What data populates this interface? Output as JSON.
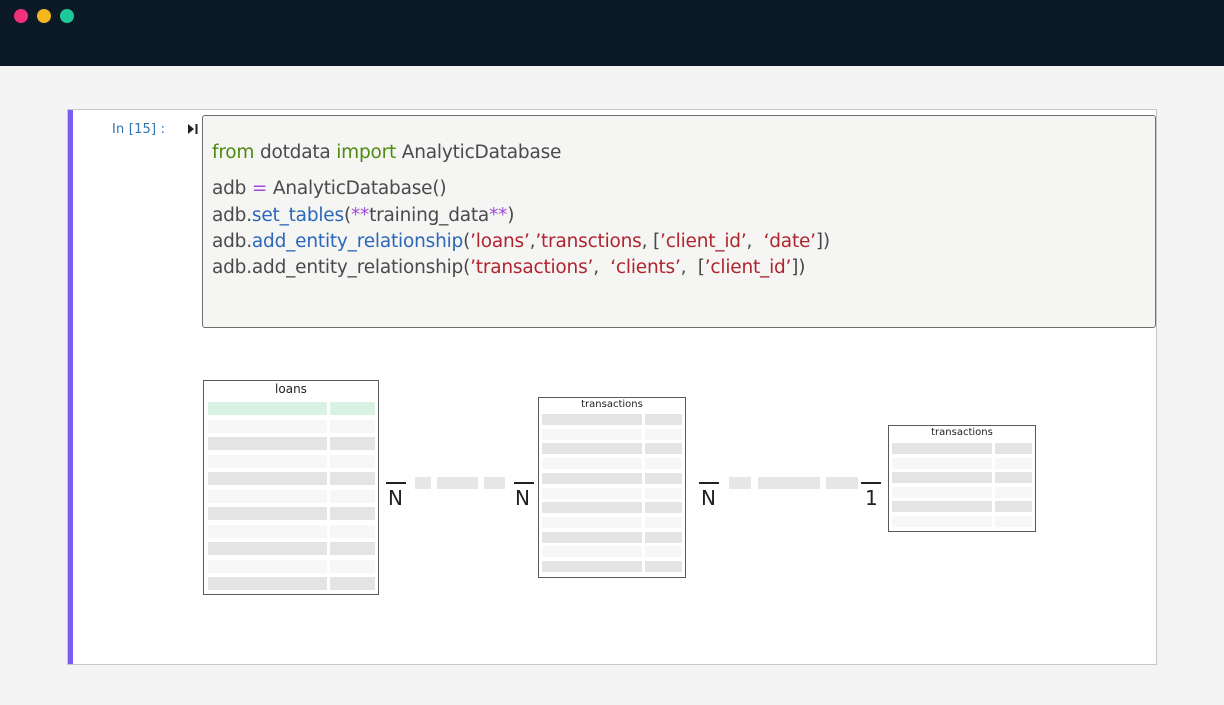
{
  "window": {
    "controls": [
      "close",
      "minimize",
      "maximize"
    ],
    "colors": {
      "titlebar": "#0b1a26",
      "close": "#f0327a",
      "minimize": "#f3b61f",
      "maximize": "#1ec89a"
    }
  },
  "cell": {
    "prompt": "In  [15] :",
    "run_icon": "run-cell-icon",
    "accent_color": "#7a5cf0",
    "code": {
      "line1": {
        "kw1": "from",
        "mod": " dotdata ",
        "kw2": "import",
        "cls": " AnalyticDatabase"
      },
      "line2": {
        "var": "adb ",
        "op": "=",
        "rest": " AnalyticDatabase()"
      },
      "line3": {
        "obj": "adb.",
        "fn": "set_tables",
        "p1": "(",
        "op1": "**",
        "arg": "training_data",
        "op2": "**",
        "p2": ")"
      },
      "line4": {
        "obj": "adb.",
        "fn": "add_entity_relationship",
        "p1": "(",
        "s1": "’loans’",
        "c1": ",",
        "s2": "’transctions",
        "c2": ", [",
        "s3": "’client_id’",
        "c3": ",  ",
        "s4": "‘date’",
        "p2": "])"
      },
      "line5": {
        "obj": "adb.add_entity_relationship(",
        "s1": "’transactions’",
        "c1": ",  ",
        "s2": "‘clients’",
        "c2": ",  [",
        "s3": "’client_id’",
        "p2": "])"
      }
    }
  },
  "diagram": {
    "tables": [
      {
        "title": "loans"
      },
      {
        "title": "transactions"
      },
      {
        "title": "transactions"
      }
    ],
    "relationships": [
      {
        "left": "N",
        "right": "N"
      },
      {
        "left": "N",
        "right": "1"
      }
    ]
  }
}
